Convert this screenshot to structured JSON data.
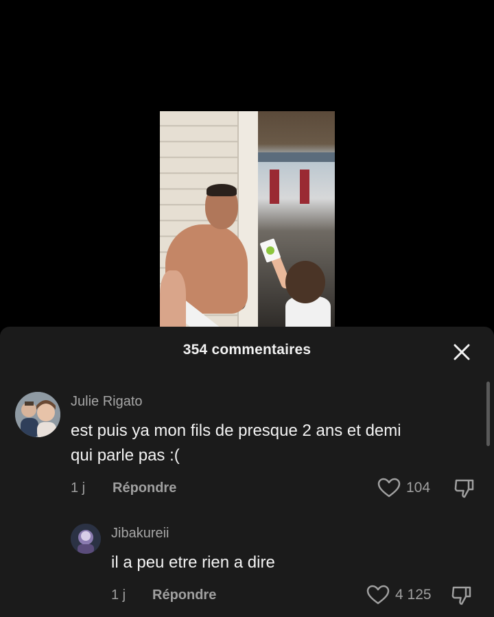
{
  "video": {},
  "sheet": {
    "title": "354 commentaires",
    "close_icon": "close-icon"
  },
  "comments": [
    {
      "user": "Julie Rigato",
      "text_line1": "est puis ya mon fils de presque 2 ans et demi",
      "text_line2": "qui parle pas :(",
      "time": "1 j",
      "reply_label": "Répondre",
      "likes": "104"
    },
    {
      "user": "Jibakureii",
      "text": "il a peu etre rien a dire",
      "time": "1 j",
      "reply_label": "Répondre",
      "likes": "4 125"
    }
  ]
}
